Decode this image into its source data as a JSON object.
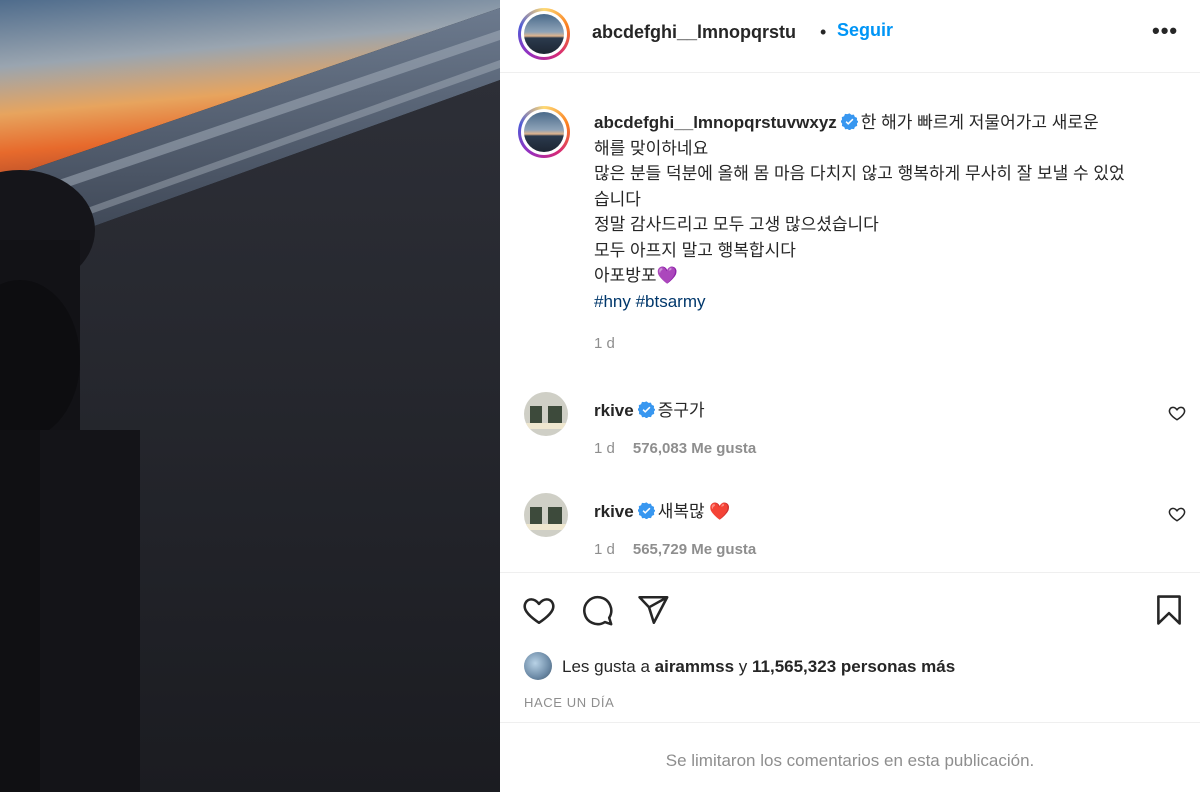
{
  "header": {
    "username": "abcdefghi__lmnopqrstu",
    "separator": "•",
    "follow_label": "Seguir",
    "more_icon": "more-horizontal-icon"
  },
  "caption": {
    "username": "abcdefghi__lmnopqrstuvwxyz",
    "lines": [
      "한 해가 빠르게 저물어가고 새로운",
      "해를 맞이하네요",
      "많은 분들 덕분에 올해 몸 마음 다치지 않고 행복하게 무사히 잘 보낼 수 있었",
      "습니다",
      "정말 감사드리고 모두 고생 많으셨습니다",
      "모두 아프지 말고 행복합시다",
      "아포방포💜"
    ],
    "hashtags": "#hny #btsarmy",
    "time": "1 d"
  },
  "comments": [
    {
      "username": "rkive",
      "text": "증구가",
      "time": "1 d",
      "likes": "576,083 Me gusta"
    },
    {
      "username": "rkive",
      "text": "새복많 ❤️",
      "time": "1 d",
      "likes": "565,729 Me gusta"
    }
  ],
  "actions": {
    "like_icon": "heart-icon",
    "comment_icon": "comment-icon",
    "share_icon": "send-icon",
    "save_icon": "bookmark-icon"
  },
  "likes": {
    "prefix": "Les gusta a",
    "user": "airammss",
    "connector": "y",
    "count": "11,565,323 personas más"
  },
  "posted_ago": "HACE UN DÍA",
  "footer": "Se limitaron los comentarios en esta publicación.",
  "colors": {
    "accent": "#0095f6",
    "hashtag": "#00376b",
    "verified": "#3897f0",
    "muted": "#8e8e8e"
  }
}
